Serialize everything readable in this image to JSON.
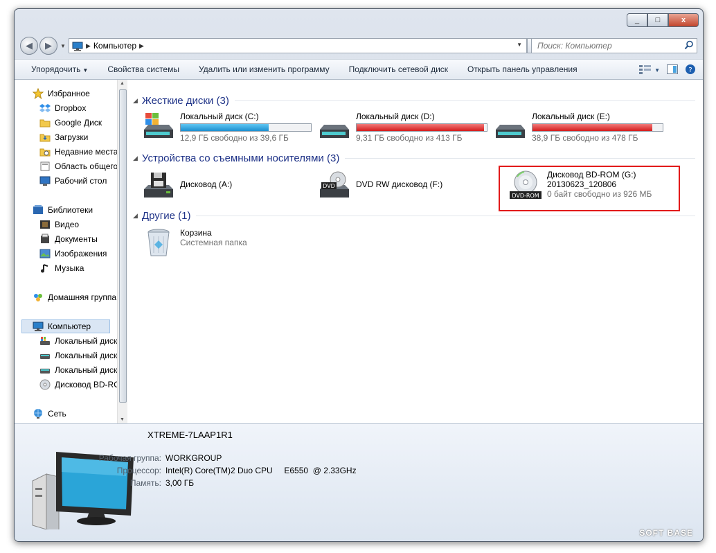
{
  "window": {
    "minimize": "_",
    "maximize": "□",
    "close": "x"
  },
  "nav": {
    "back": "◀",
    "forward": "▶",
    "dropdown": "▼"
  },
  "address": {
    "crumb": "Компьютер",
    "sep1": "▶",
    "sep2": "▶",
    "dropdown": "▼"
  },
  "refresh": "⟳",
  "search": {
    "placeholder": "Поиск: Компьютер"
  },
  "toolbar": {
    "organize": "Упорядочить",
    "organize_arrow": "▼",
    "system_props": "Свойства системы",
    "uninstall": "Удалить или изменить программу",
    "map_drive": "Подключить сетевой диск",
    "control_panel": "Открыть панель управления",
    "views_arrow": "▼"
  },
  "sidebar": {
    "favorites": "Избранное",
    "dropbox": "Dropbox",
    "google_drive": "Google Диск",
    "downloads": "Загрузки",
    "recent": "Недавние места",
    "public": "Область общего",
    "desktop": "Рабочий стол",
    "libraries": "Библиотеки",
    "video": "Видео",
    "documents": "Документы",
    "pictures": "Изображения",
    "music": "Музыка",
    "homegroup": "Домашняя группа",
    "computer": "Компьютер",
    "local_c": "Локальный диск",
    "local_d": "Локальный диск",
    "local_e": "Локальный диск",
    "bdrom": "Дисковод BD-RO",
    "network": "Сеть"
  },
  "groups": {
    "hdd": "Жесткие диски (3)",
    "removable": "Устройства со съемными носителями (3)",
    "other": "Другие (1)"
  },
  "drives": {
    "c": {
      "name": "Локальный диск (C:)",
      "free": "12,9 ГБ свободно из 39,6 ГБ",
      "used_fraction": 0.674
    },
    "d": {
      "name": "Локальный диск (D:)",
      "free": "9,31 ГБ свободно из 413 ГБ",
      "used_fraction": 0.977
    },
    "e": {
      "name": "Локальный диск (E:)",
      "free": "38,9 ГБ свободно из 478 ГБ",
      "used_fraction": 0.919
    },
    "floppy": {
      "name": "Дисковод (A:)"
    },
    "dvd": {
      "name": "DVD RW дисковод (F:)",
      "badge": "DVD"
    },
    "bd": {
      "name": "Дисковод BD-ROM (G:)",
      "label": "20130623_120806",
      "free": "0 байт свободно из 926 МБ",
      "badge": "DVD-ROM"
    },
    "recycle": {
      "name": "Корзина",
      "sub": "Системная папка"
    }
  },
  "details": {
    "name": "XTREME-7LAAP1R1",
    "workgroup_label": "Рабочая группа:",
    "workgroup": "WORKGROUP",
    "cpu_label": "Процессор:",
    "cpu": "Intel(R) Core(TM)2 Duo CPU     E6550  @ 2.33GHz",
    "ram_label": "Память:",
    "ram": "3,00 ГБ"
  },
  "watermark": "SOFT BASE"
}
